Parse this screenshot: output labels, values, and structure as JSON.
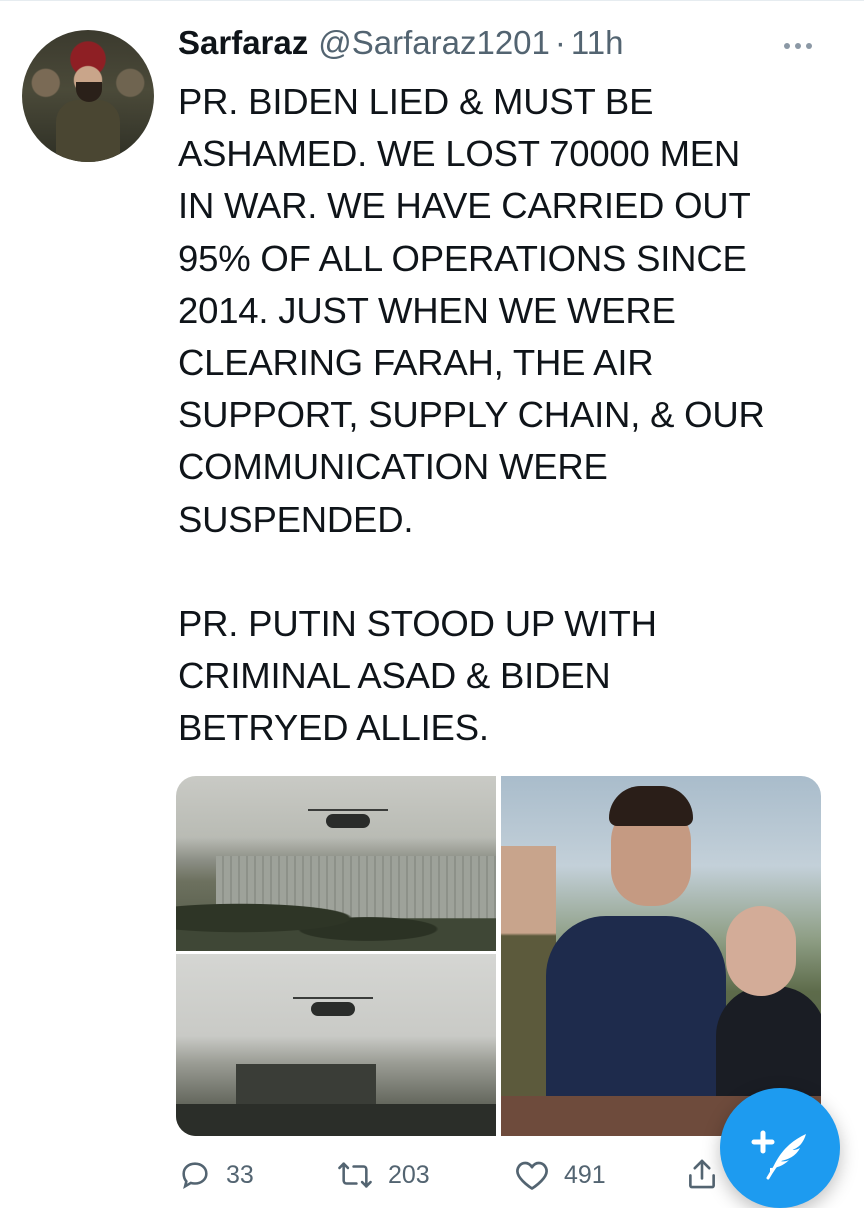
{
  "tweet": {
    "author_name": "Sarfaraz",
    "author_handle": "@Sarfaraz1201",
    "separator": "·",
    "time": "11h",
    "text": "PR. BIDEN LIED & MUST BE\nASHAMED. WE LOST 70000 MEN\nIN WAR. WE HAVE CARRIED OUT\n95% OF ALL OPERATIONS SINCE\n2014. JUST WHEN WE WERE\nCLEARING FARAH, THE AIR\nSUPPORT, SUPPLY CHAIN, & OUR\nCOMMUNICATION WERE\nSUSPENDED.\n\nPR. PUTIN STOOD UP WITH\nCRIMINAL ASAD & BIDEN\nBETRYED ALLIES."
  },
  "actions": {
    "reply_count": "33",
    "retweet_count": "203",
    "like_count": "491"
  },
  "icons": {
    "more": "more-icon",
    "reply": "reply-icon",
    "retweet": "retweet-icon",
    "like": "heart-icon",
    "share": "share-icon",
    "compose": "compose-tweet-icon"
  },
  "colors": {
    "accent": "#1d9bf0",
    "secondary_text": "#536471",
    "text": "#0f1419"
  }
}
